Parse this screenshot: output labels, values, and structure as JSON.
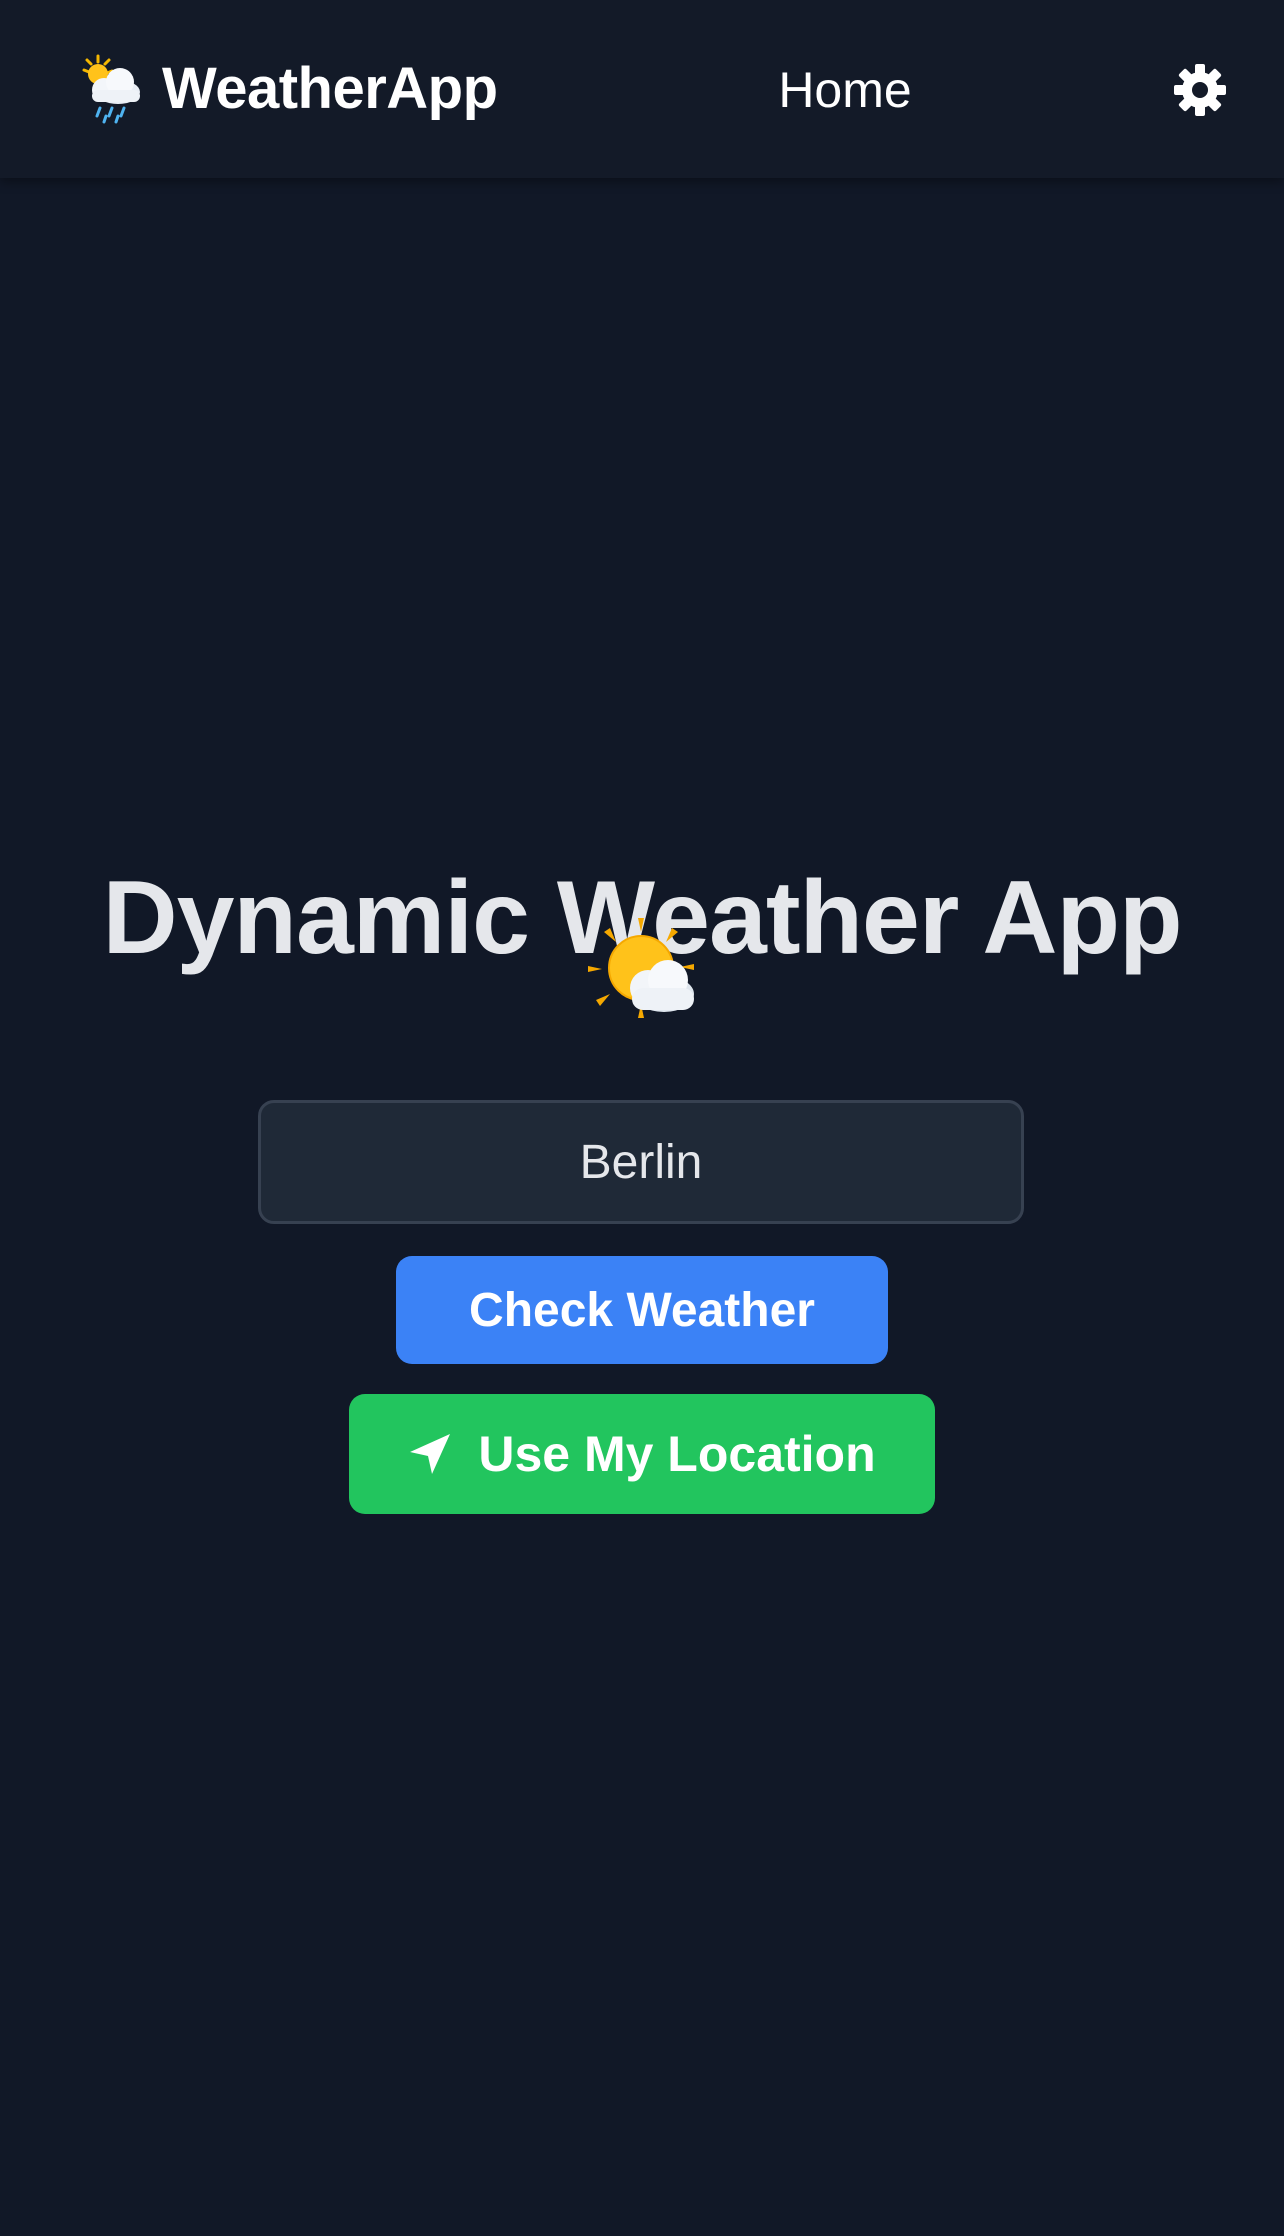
{
  "navbar": {
    "brand_icon": "sun-cloud-rain-icon",
    "brand_name": "WeatherApp",
    "home_link": "Home",
    "settings_icon": "gear-icon"
  },
  "hero": {
    "title": "Dynamic Weather App",
    "title_icon": "sun-behind-cloud-icon"
  },
  "search": {
    "city_value": "Berlin",
    "check_button": "Check Weather",
    "location_button": "Use My Location",
    "location_icon": "location-arrow-icon"
  },
  "colors": {
    "background": "#111827",
    "navbar": "#131a28",
    "input_bg": "#1f2937",
    "primary": "#3b82f6",
    "success": "#22c55e",
    "text": "#e5e7eb"
  }
}
